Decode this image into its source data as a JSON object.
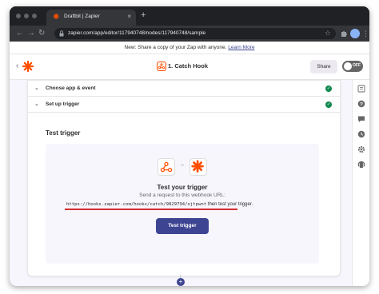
{
  "browser": {
    "tab_title": "Draftbit | Zapier",
    "tab_close": "×",
    "new_tab": "+",
    "url": "zapier.com/app/editor/117940748/nodes/117940748/sample"
  },
  "banner": {
    "text": "New: Share a copy of your Zap with anyone.",
    "link": "Learn More"
  },
  "header": {
    "back": "‹",
    "step_title": "1. Catch Hook",
    "share_label": "Share",
    "toggle_label": "OFF"
  },
  "accordion": {
    "items": [
      {
        "label": "Choose app & event"
      },
      {
        "label": "Set up trigger"
      }
    ]
  },
  "test_section": {
    "title": "Test trigger",
    "heading": "Test your trigger",
    "instruction": "Send a request to this webhook URL:",
    "webhook_url": "https://hooks.zapier.com/hooks/catch/9829794/ojtpwnt",
    "url_suffix": " then test your trigger.",
    "button_label": "Test trigger"
  },
  "colors": {
    "accent": "#3d4592",
    "zapier_orange": "#ff4f00",
    "success": "#0f884e",
    "underline": "#d32f2f"
  }
}
